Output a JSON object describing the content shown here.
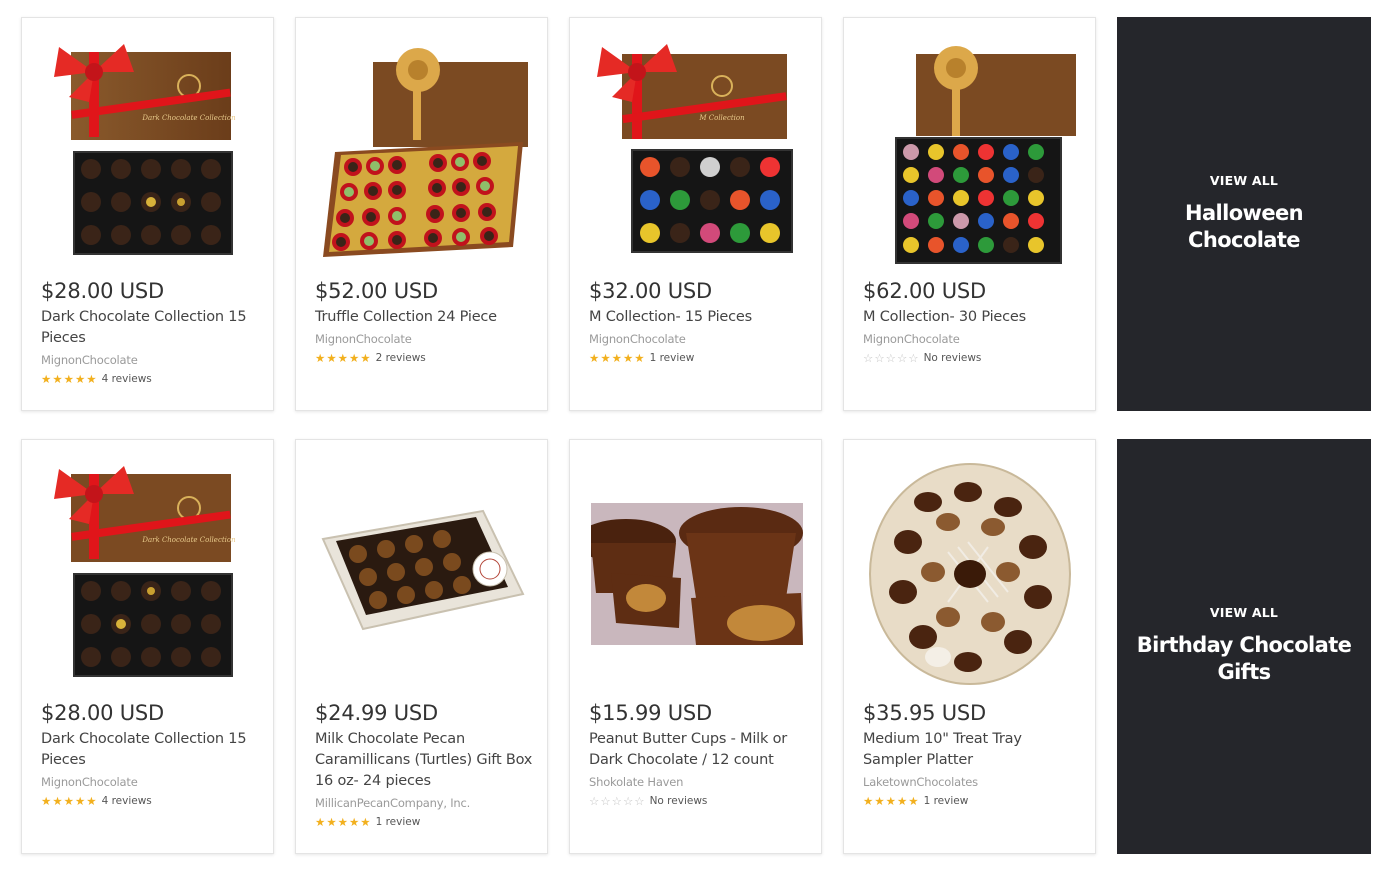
{
  "row1": {
    "products": [
      {
        "price": "$28.00 USD",
        "title": "Dark Chocolate Collection 15 Pieces",
        "vendor": "MignonChocolate",
        "rating": 5,
        "reviews": "4 reviews",
        "image": "red-bow-15-dark-box",
        "box_label": "Dark Chocolate Collection"
      },
      {
        "price": "$52.00 USD",
        "title": "Truffle Collection 24 Piece",
        "vendor": "MignonChocolate",
        "rating": 5,
        "reviews": "2 reviews",
        "image": "gold-bow-24-truffle-box"
      },
      {
        "price": "$32.00 USD",
        "title": "M Collection- 15 Pieces",
        "vendor": "MignonChocolate",
        "rating": 5,
        "reviews": "1 review",
        "image": "red-bow-15-colored-box",
        "box_label": "M Collection"
      },
      {
        "price": "$62.00 USD",
        "title": "M Collection- 30 Pieces",
        "vendor": "MignonChocolate",
        "rating": 0,
        "reviews": "No reviews",
        "image": "gold-bow-30-colored-box"
      }
    ],
    "promo": {
      "view_all": "VIEW ALL",
      "title": "Halloween Chocolate"
    }
  },
  "row2": {
    "products": [
      {
        "price": "$28.00 USD",
        "title": "Dark Chocolate Collection 15 Pieces",
        "vendor": "MignonChocolate",
        "rating": 5,
        "reviews": "4 reviews",
        "image": "red-bow-15-dark-box",
        "box_label": "Dark Chocolate Collection"
      },
      {
        "price": "$24.99 USD",
        "title": "Milk Chocolate Pecan Caramillicans (Turtles) Gift Box 16 oz- 24 pieces",
        "vendor": "MillicanPecanCompany, Inc.",
        "rating": 5,
        "reviews": "1 review",
        "image": "pecan-turtles-box"
      },
      {
        "price": "$15.99 USD",
        "title": "Peanut Butter Cups - Milk or Dark Chocolate / 12 count",
        "vendor": "Shokolate Haven",
        "rating": 0,
        "reviews": "No reviews",
        "image": "peanut-butter-cups-photo"
      },
      {
        "price": "$35.95 USD",
        "title": "Medium 10\" Treat Tray Sampler Platter",
        "vendor": "LaketownChocolates",
        "rating": 5,
        "reviews": "1 review",
        "image": "treat-tray-platter"
      }
    ],
    "promo": {
      "view_all": "VIEW ALL",
      "title": "Birthday Chocolate Gifts"
    }
  },
  "colors": {
    "star": "#f2b01e",
    "star_empty": "#c4c4c4",
    "promo_bg": "#25262b",
    "price": "#333333",
    "vendor": "#9a9a9a"
  }
}
